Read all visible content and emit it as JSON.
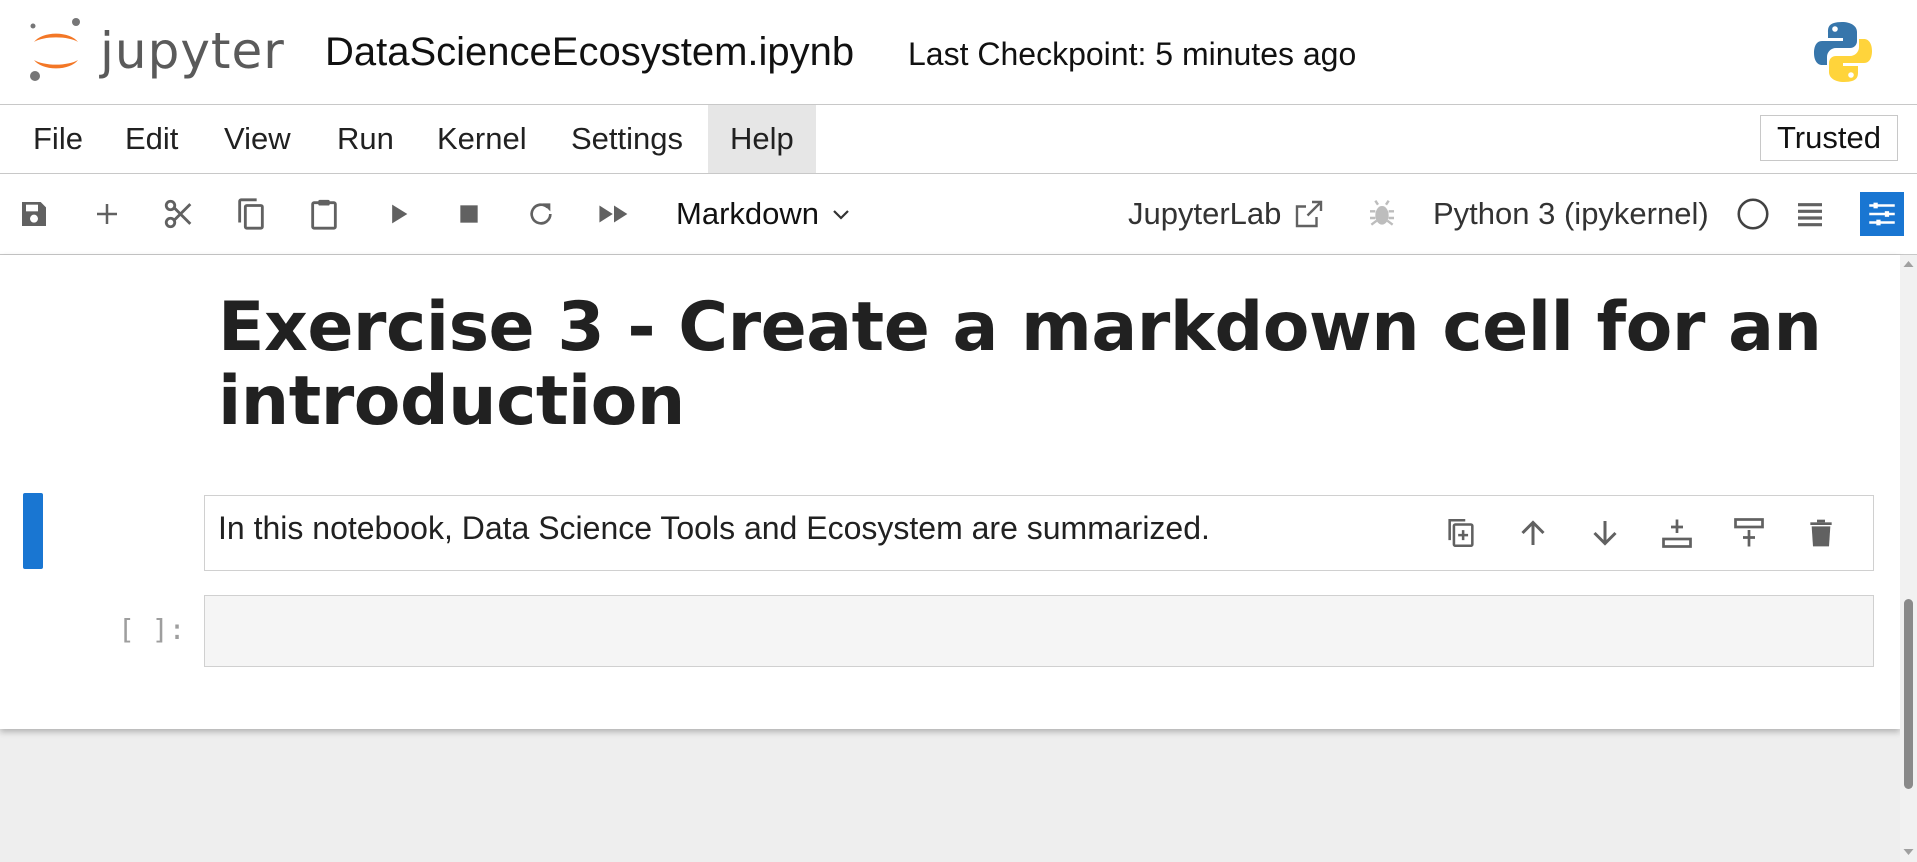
{
  "header": {
    "logo_text": "jupyter",
    "notebook_title": "DataScienceEcosystem.ipynb",
    "checkpoint": "Last Checkpoint: 5 minutes ago",
    "kernel_logo": "python-logo-icon"
  },
  "menu": {
    "items": [
      "File",
      "Edit",
      "View",
      "Run",
      "Kernel",
      "Settings",
      "Help"
    ],
    "active": "Help",
    "trusted_label": "Trusted"
  },
  "toolbar": {
    "buttons": [
      "save-icon",
      "add-cell-icon",
      "cut-icon",
      "copy-icon",
      "paste-icon",
      "run-icon",
      "stop-icon",
      "restart-icon",
      "run-all-icon"
    ],
    "cell_type": "Markdown",
    "jupyterlab_label": "JupyterLab",
    "kernel_name": "Python 3 (ipykernel)",
    "kernel_status": "idle",
    "accent_color": "#1976d2"
  },
  "notebook": {
    "heading": "Exercise 3 - Create a markdown cell for an introduction",
    "markdown_cell_text": "In this notebook, Data Science Tools and Ecosystem are summarized.",
    "code_prompt": "[ ]:",
    "code_cell_content": ""
  }
}
